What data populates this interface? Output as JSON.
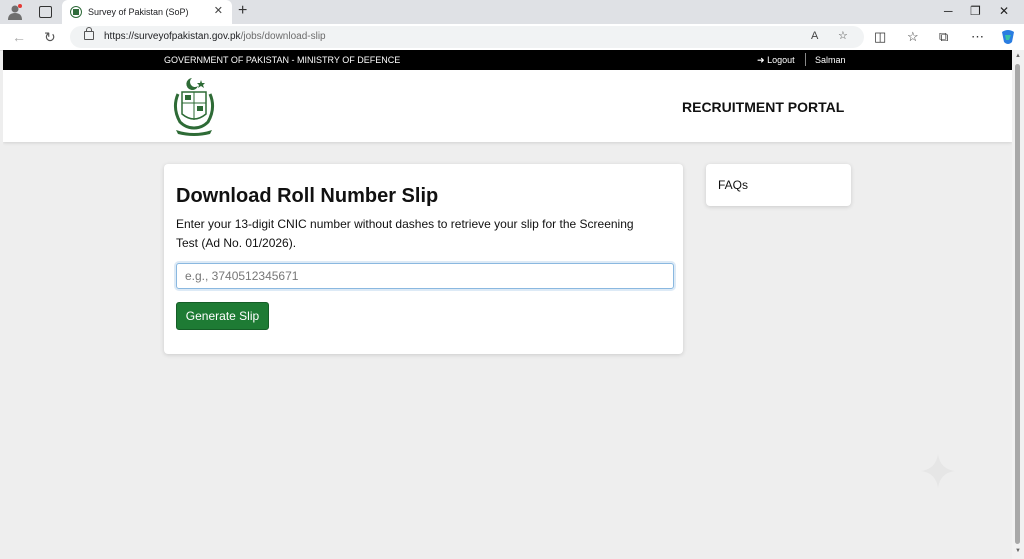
{
  "browser": {
    "tab_title": "Survey of Pakistan (SoP)",
    "url_host": "https://surveyofpakistan.gov.pk",
    "url_path": "/jobs/download-slip"
  },
  "topbar": {
    "ministry": "GOVERNMENT OF PAKISTAN - MINISTRY OF DEFENCE",
    "logout_label": "Logout",
    "username": "Salman"
  },
  "header": {
    "portal_title": "RECRUITMENT PORTAL"
  },
  "main": {
    "heading": "Download Roll Number Slip",
    "description": "Enter your 13-digit CNIC number without dashes to retrieve your slip for the Screening Test (Ad No. 01/2026).",
    "cnic_placeholder": "e.g., 3740512345671",
    "button_label": "Generate Slip"
  },
  "sidebar": {
    "faq_label": "FAQs"
  },
  "colors": {
    "topbar": "#000000",
    "button_green": "#1e7b34",
    "input_focus": "#8ab8e0",
    "page_bg": "#eeeeee"
  }
}
